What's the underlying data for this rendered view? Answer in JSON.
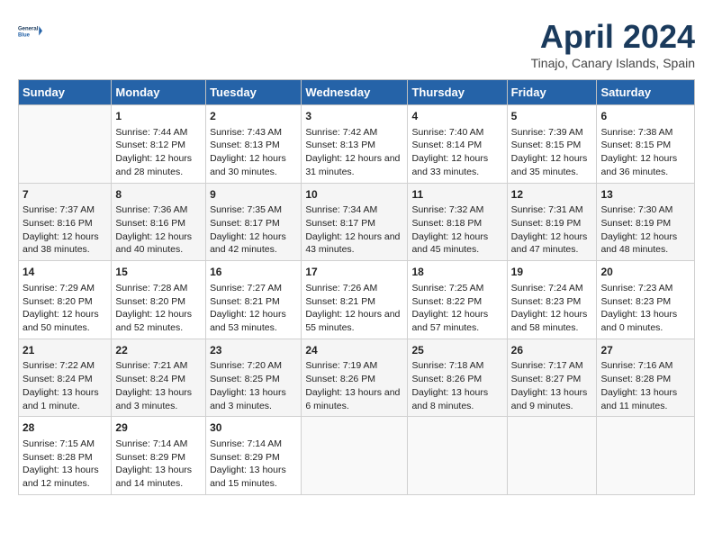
{
  "logo": {
    "line1": "General",
    "line2": "Blue"
  },
  "title": "April 2024",
  "subtitle": "Tinajo, Canary Islands, Spain",
  "headers": [
    "Sunday",
    "Monday",
    "Tuesday",
    "Wednesday",
    "Thursday",
    "Friday",
    "Saturday"
  ],
  "weeks": [
    [
      {
        "day": "",
        "sunrise": "",
        "sunset": "",
        "daylight": ""
      },
      {
        "day": "1",
        "sunrise": "Sunrise: 7:44 AM",
        "sunset": "Sunset: 8:12 PM",
        "daylight": "Daylight: 12 hours and 28 minutes."
      },
      {
        "day": "2",
        "sunrise": "Sunrise: 7:43 AM",
        "sunset": "Sunset: 8:13 PM",
        "daylight": "Daylight: 12 hours and 30 minutes."
      },
      {
        "day": "3",
        "sunrise": "Sunrise: 7:42 AM",
        "sunset": "Sunset: 8:13 PM",
        "daylight": "Daylight: 12 hours and 31 minutes."
      },
      {
        "day": "4",
        "sunrise": "Sunrise: 7:40 AM",
        "sunset": "Sunset: 8:14 PM",
        "daylight": "Daylight: 12 hours and 33 minutes."
      },
      {
        "day": "5",
        "sunrise": "Sunrise: 7:39 AM",
        "sunset": "Sunset: 8:15 PM",
        "daylight": "Daylight: 12 hours and 35 minutes."
      },
      {
        "day": "6",
        "sunrise": "Sunrise: 7:38 AM",
        "sunset": "Sunset: 8:15 PM",
        "daylight": "Daylight: 12 hours and 36 minutes."
      }
    ],
    [
      {
        "day": "7",
        "sunrise": "Sunrise: 7:37 AM",
        "sunset": "Sunset: 8:16 PM",
        "daylight": "Daylight: 12 hours and 38 minutes."
      },
      {
        "day": "8",
        "sunrise": "Sunrise: 7:36 AM",
        "sunset": "Sunset: 8:16 PM",
        "daylight": "Daylight: 12 hours and 40 minutes."
      },
      {
        "day": "9",
        "sunrise": "Sunrise: 7:35 AM",
        "sunset": "Sunset: 8:17 PM",
        "daylight": "Daylight: 12 hours and 42 minutes."
      },
      {
        "day": "10",
        "sunrise": "Sunrise: 7:34 AM",
        "sunset": "Sunset: 8:17 PM",
        "daylight": "Daylight: 12 hours and 43 minutes."
      },
      {
        "day": "11",
        "sunrise": "Sunrise: 7:32 AM",
        "sunset": "Sunset: 8:18 PM",
        "daylight": "Daylight: 12 hours and 45 minutes."
      },
      {
        "day": "12",
        "sunrise": "Sunrise: 7:31 AM",
        "sunset": "Sunset: 8:19 PM",
        "daylight": "Daylight: 12 hours and 47 minutes."
      },
      {
        "day": "13",
        "sunrise": "Sunrise: 7:30 AM",
        "sunset": "Sunset: 8:19 PM",
        "daylight": "Daylight: 12 hours and 48 minutes."
      }
    ],
    [
      {
        "day": "14",
        "sunrise": "Sunrise: 7:29 AM",
        "sunset": "Sunset: 8:20 PM",
        "daylight": "Daylight: 12 hours and 50 minutes."
      },
      {
        "day": "15",
        "sunrise": "Sunrise: 7:28 AM",
        "sunset": "Sunset: 8:20 PM",
        "daylight": "Daylight: 12 hours and 52 minutes."
      },
      {
        "day": "16",
        "sunrise": "Sunrise: 7:27 AM",
        "sunset": "Sunset: 8:21 PM",
        "daylight": "Daylight: 12 hours and 53 minutes."
      },
      {
        "day": "17",
        "sunrise": "Sunrise: 7:26 AM",
        "sunset": "Sunset: 8:21 PM",
        "daylight": "Daylight: 12 hours and 55 minutes."
      },
      {
        "day": "18",
        "sunrise": "Sunrise: 7:25 AM",
        "sunset": "Sunset: 8:22 PM",
        "daylight": "Daylight: 12 hours and 57 minutes."
      },
      {
        "day": "19",
        "sunrise": "Sunrise: 7:24 AM",
        "sunset": "Sunset: 8:23 PM",
        "daylight": "Daylight: 12 hours and 58 minutes."
      },
      {
        "day": "20",
        "sunrise": "Sunrise: 7:23 AM",
        "sunset": "Sunset: 8:23 PM",
        "daylight": "Daylight: 13 hours and 0 minutes."
      }
    ],
    [
      {
        "day": "21",
        "sunrise": "Sunrise: 7:22 AM",
        "sunset": "Sunset: 8:24 PM",
        "daylight": "Daylight: 13 hours and 1 minute."
      },
      {
        "day": "22",
        "sunrise": "Sunrise: 7:21 AM",
        "sunset": "Sunset: 8:24 PM",
        "daylight": "Daylight: 13 hours and 3 minutes."
      },
      {
        "day": "23",
        "sunrise": "Sunrise: 7:20 AM",
        "sunset": "Sunset: 8:25 PM",
        "daylight": "Daylight: 13 hours and 3 minutes."
      },
      {
        "day": "24",
        "sunrise": "Sunrise: 7:19 AM",
        "sunset": "Sunset: 8:26 PM",
        "daylight": "Daylight: 13 hours and 6 minutes."
      },
      {
        "day": "25",
        "sunrise": "Sunrise: 7:18 AM",
        "sunset": "Sunset: 8:26 PM",
        "daylight": "Daylight: 13 hours and 8 minutes."
      },
      {
        "day": "26",
        "sunrise": "Sunrise: 7:17 AM",
        "sunset": "Sunset: 8:27 PM",
        "daylight": "Daylight: 13 hours and 9 minutes."
      },
      {
        "day": "27",
        "sunrise": "Sunrise: 7:16 AM",
        "sunset": "Sunset: 8:28 PM",
        "daylight": "Daylight: 13 hours and 11 minutes."
      }
    ],
    [
      {
        "day": "28",
        "sunrise": "Sunrise: 7:15 AM",
        "sunset": "Sunset: 8:28 PM",
        "daylight": "Daylight: 13 hours and 12 minutes."
      },
      {
        "day": "29",
        "sunrise": "Sunrise: 7:14 AM",
        "sunset": "Sunset: 8:29 PM",
        "daylight": "Daylight: 13 hours and 14 minutes."
      },
      {
        "day": "30",
        "sunrise": "Sunrise: 7:14 AM",
        "sunset": "Sunset: 8:29 PM",
        "daylight": "Daylight: 13 hours and 15 minutes."
      },
      {
        "day": "",
        "sunrise": "",
        "sunset": "",
        "daylight": ""
      },
      {
        "day": "",
        "sunrise": "",
        "sunset": "",
        "daylight": ""
      },
      {
        "day": "",
        "sunrise": "",
        "sunset": "",
        "daylight": ""
      },
      {
        "day": "",
        "sunrise": "",
        "sunset": "",
        "daylight": ""
      }
    ]
  ]
}
